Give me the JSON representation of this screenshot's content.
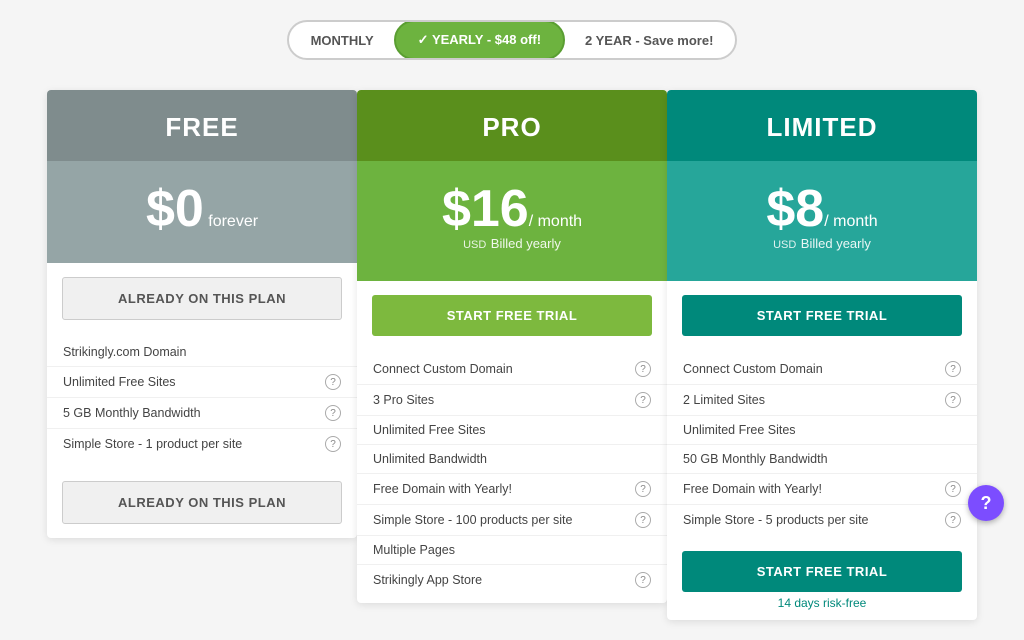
{
  "toggle": {
    "options": [
      {
        "id": "monthly",
        "label": "MONTHLY",
        "active": false
      },
      {
        "id": "yearly",
        "label": "✓ YEARLY - $48 off!",
        "active": true
      },
      {
        "id": "2year",
        "label": "2 YEAR - Save more!",
        "active": false
      }
    ]
  },
  "cards": {
    "free": {
      "title": "FREE",
      "price": "$0",
      "price_suffix": "forever",
      "cta_top": "ALREADY ON THIS PLAN",
      "features": [
        "Strikingly.com Domain",
        "Unlimited Free Sites",
        "5 GB Monthly Bandwidth",
        "Simple Store - 1 product per site"
      ],
      "features_info": [
        false,
        true,
        true,
        true
      ],
      "cta_bottom": "ALREADY ON THIS PLAN"
    },
    "pro": {
      "title": "PRO",
      "price": "$16",
      "price_unit": "/ month",
      "usd": "USD",
      "billed": "Billed yearly",
      "cta_top": "START FREE TRIAL",
      "features": [
        "Connect Custom Domain",
        "3 Pro Sites",
        "Unlimited Free Sites",
        "Unlimited Bandwidth",
        "Free Domain with Yearly!",
        "Simple Store - 100 products per site",
        "Multiple Pages",
        "Strikingly App Store"
      ],
      "features_info": [
        true,
        true,
        false,
        false,
        true,
        true,
        false,
        true
      ]
    },
    "limited": {
      "title": "LIMITED",
      "price": "$8",
      "price_unit": "/ month",
      "usd": "USD",
      "billed": "Billed yearly",
      "cta_top": "START FREE TRIAL",
      "features": [
        "Connect Custom Domain",
        "2 Limited Sites",
        "Unlimited Free Sites",
        "50 GB Monthly Bandwidth",
        "Free Domain with Yearly!",
        "Simple Store - 5 products per site"
      ],
      "features_info": [
        true,
        true,
        false,
        false,
        true,
        true
      ],
      "cta_bottom": "START FREE TRIAL",
      "risk_free": "14 days risk-free"
    }
  },
  "help": "?"
}
